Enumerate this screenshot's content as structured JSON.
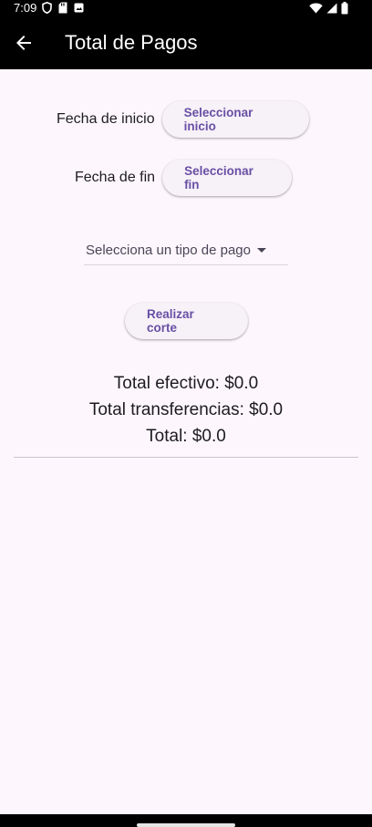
{
  "status_bar": {
    "time": "7:09",
    "left_icons": [
      "shield-icon",
      "sd-card-icon",
      "notification-icon"
    ],
    "right_icons": [
      "wifi-icon",
      "signal-icon",
      "battery-icon"
    ]
  },
  "app_bar": {
    "title": "Total de Pagos",
    "back_icon": "arrow-back-icon"
  },
  "fecha_inicio": {
    "label": "Fecha de inicio",
    "button_label": "Seleccionar inicio"
  },
  "fecha_fin": {
    "label": "Fecha de fin",
    "button_label": "Seleccionar fin"
  },
  "tipo_pago": {
    "selected_text": "Selecciona un tipo de pago",
    "arrow_icon": "dropdown-arrow-icon"
  },
  "corte": {
    "button_label": "Realizar corte"
  },
  "totals": {
    "efectivo": "Total efectivo: $0.0",
    "transferencias": "Total transferencias: $0.0",
    "total": "Total: $0.0"
  },
  "colors": {
    "background": "#fdf7fd",
    "app_bar": "#000000",
    "button_text": "#6750a4",
    "button_bg": "#f7f1f8"
  }
}
